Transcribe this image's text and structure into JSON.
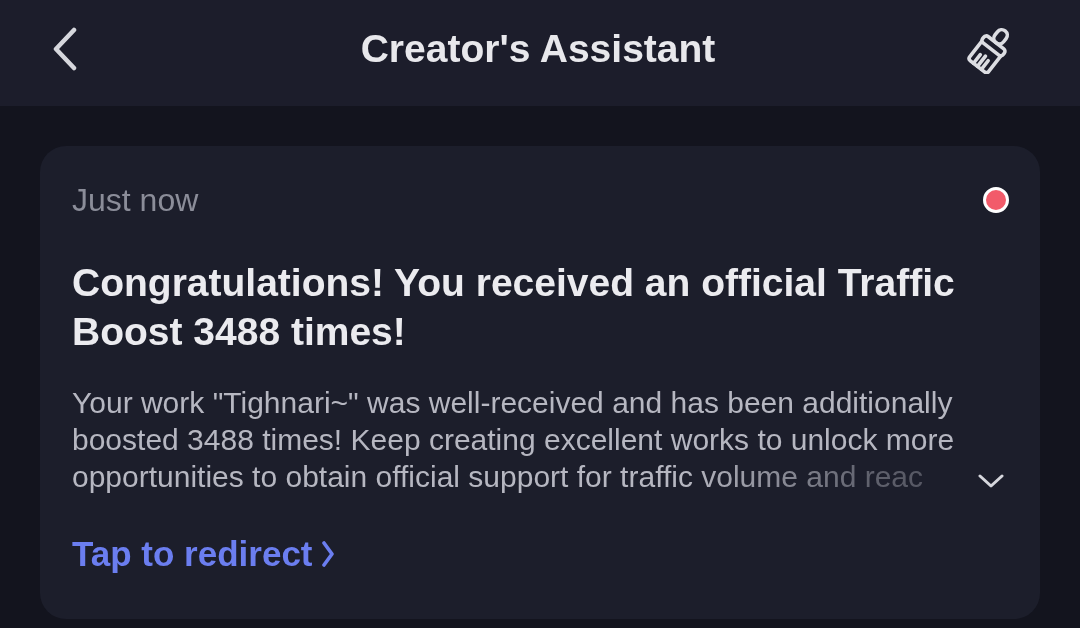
{
  "header": {
    "title": "Creator's Assistant"
  },
  "notifications": [
    {
      "time": "Just now",
      "unread": true,
      "title": "Congratulations! You received an official Traffic Boost 3488 times!",
      "body": "Your work \"Tighnari~\" was well-received and has been additionally boosted 3488 times! Keep creating excellent works to unlock more opportunities to obtain official support for traffic volume and reac",
      "expanded": false,
      "link": "Tap to redirect"
    }
  ]
}
